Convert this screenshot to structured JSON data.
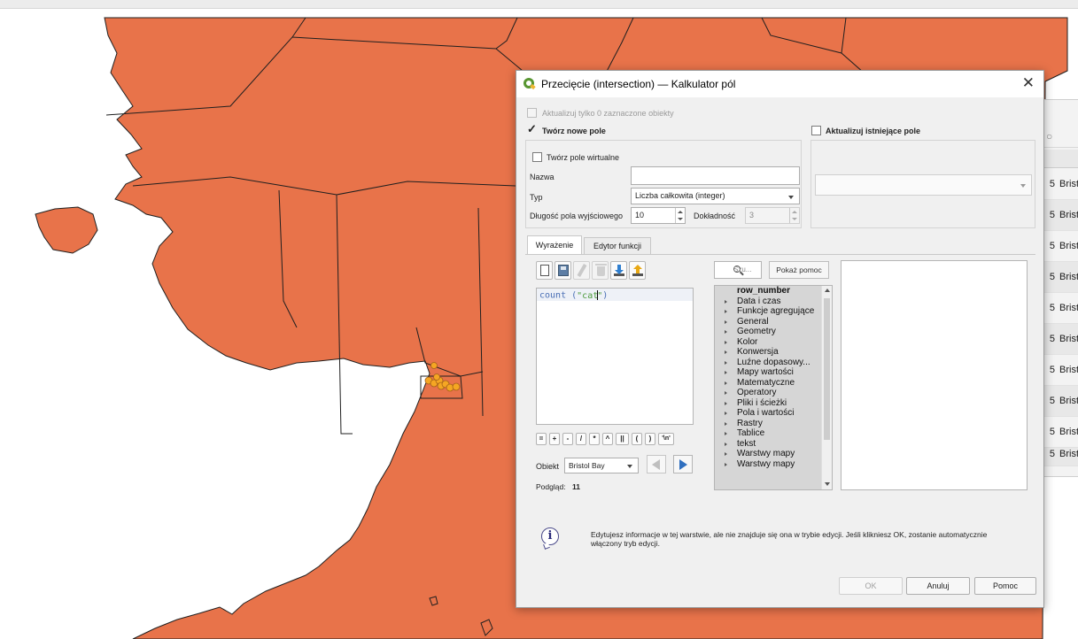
{
  "dialog": {
    "title": "Przecięcie (intersection) — Kalkulator pól",
    "update_selected_label": "Aktualizuj tylko 0 zaznaczone obiekty",
    "create_new_field_label": "Twórz nowe pole",
    "create_new_field_checked": true,
    "update_existing_field_label": "Aktualizuj istniejące pole",
    "create_virtual_field_label": "Twórz pole wirtualne",
    "name_label": "Nazwa",
    "name_value": "",
    "type_label": "Typ",
    "type_value": "Liczba całkowita (integer)",
    "output_length_label": "Długość pola wyjściowego",
    "output_length_value": "10",
    "precision_label": "Dokładność",
    "precision_value": "3",
    "existing_field_value": ""
  },
  "tabs": [
    {
      "label": "Wyrażenie",
      "active": true
    },
    {
      "label": "Edytor funkcji",
      "active": false
    }
  ],
  "toolbar_icons": [
    "new-icon",
    "save-icon",
    "edit-icon",
    "delete-icon",
    "load-icon",
    "export-icon"
  ],
  "expression": {
    "func": "count",
    "arg": "\"cat\""
  },
  "operators": [
    "=",
    "+",
    "-",
    "/",
    "*",
    "^",
    "||",
    "(",
    ")",
    "'\\n'"
  ],
  "feature": {
    "label": "Obiekt",
    "value": "Bristol Bay"
  },
  "preview": {
    "label": "Podgląd:",
    "value": "11"
  },
  "function_search_placeholder": "Szu...",
  "show_help_label": "Pokaż pomoc",
  "function_tree": [
    {
      "label": "row_number",
      "selected": true,
      "expandable": false
    },
    {
      "label": "Data i czas",
      "expandable": true
    },
    {
      "label": "Funkcje agregujące",
      "expandable": true
    },
    {
      "label": "General",
      "expandable": true
    },
    {
      "label": "Geometry",
      "expandable": true
    },
    {
      "label": "Kolor",
      "expandable": true
    },
    {
      "label": "Konwersja",
      "expandable": true
    },
    {
      "label": "Luźne dopasowy...",
      "expandable": true
    },
    {
      "label": "Mapy wartości",
      "expandable": true
    },
    {
      "label": "Matematyczne",
      "expandable": true
    },
    {
      "label": "Operatory",
      "expandable": true
    },
    {
      "label": "Pliki i ścieżki",
      "expandable": true
    },
    {
      "label": "Pola i wartości",
      "expandable": true
    },
    {
      "label": "Rastry",
      "expandable": true
    },
    {
      "label": "Tablice",
      "expandable": true
    },
    {
      "label": "tekst",
      "expandable": true
    },
    {
      "label": "Warstwy mapy",
      "expandable": true
    },
    {
      "label": "Warstwy mapy",
      "expandable": true
    }
  ],
  "info_message": "Edytujesz informacje w tej warstwie, ale nie znajduje się ona w trybie edycji. Jeśli klikniesz OK, zostanie automatycznie włączony tryb edycji.",
  "buttons": {
    "ok": "OK",
    "cancel": "Anuluj",
    "help": "Pomoc"
  },
  "background_table": {
    "rows": [
      {
        "n": "5",
        "t": "Brist"
      },
      {
        "n": "5",
        "t": "Brist"
      },
      {
        "n": "5",
        "t": "Brist"
      },
      {
        "n": "5",
        "t": "Brist"
      },
      {
        "n": "5",
        "t": "Brist"
      },
      {
        "n": "5",
        "t": "Brist"
      },
      {
        "n": "5",
        "t": "Brist"
      },
      {
        "n": "5",
        "t": "Brist"
      },
      {
        "n": "5",
        "t": "Brist"
      },
      {
        "n": "5",
        "t": "Brist"
      }
    ]
  },
  "map": {
    "land_color": "#e8734a",
    "border_color": "#1f1f1f",
    "point_color": "#f5a623",
    "background_color": "#ffffff"
  }
}
